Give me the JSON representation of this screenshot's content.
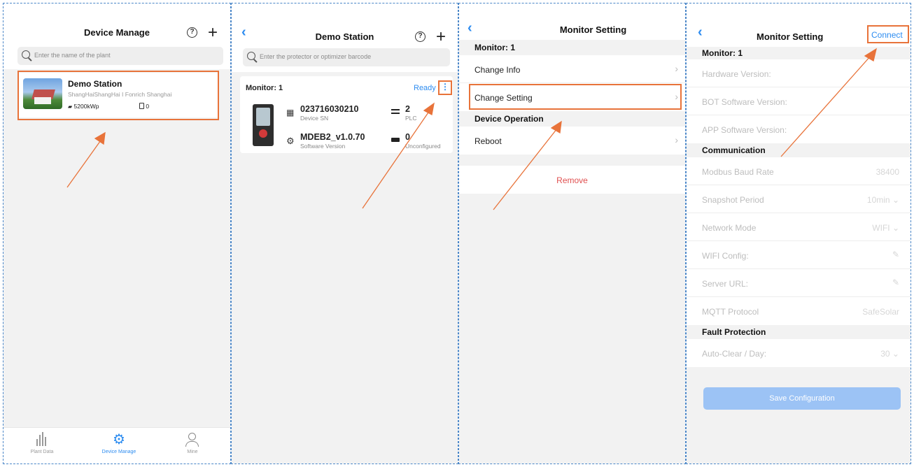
{
  "colors": {
    "accent": "#2d8cf0",
    "highlight": "#e8733a",
    "danger": "#e05050"
  },
  "panel1": {
    "title": "Device Manage",
    "search_placeholder": "Enter the name of the plant",
    "station": {
      "name": "Demo Station",
      "address": "ShangHaiShangHai I Fonrich Shanghai",
      "capacity": "5200kWp",
      "count": "0"
    },
    "tabbar": [
      {
        "label": "Plant Data",
        "icon": "bar-chart-icon"
      },
      {
        "label": "Device Manage",
        "icon": "gear-icon"
      },
      {
        "label": "Mine",
        "icon": "user-icon"
      }
    ]
  },
  "panel2": {
    "title": "Demo Station",
    "search_placeholder": "Enter the protector or optimizer barcode",
    "monitor_label": "Monitor: 1",
    "status": "Ready",
    "device_sn": "023716030210",
    "device_sn_label": "Device SN",
    "plc_count": "2",
    "plc_label": "PLC",
    "software_version": "MDEB2_v1.0.70",
    "software_version_label": "Software Version",
    "unconfigured_count": "0",
    "unconfigured_label": "Unconfigured"
  },
  "panel3": {
    "title": "Monitor Setting",
    "monitor_label": "Monitor: 1",
    "change_info": "Change Info",
    "change_setting": "Change Setting",
    "device_operation": "Device Operation",
    "reboot": "Reboot",
    "remove": "Remove"
  },
  "panel4": {
    "title": "Monitor Setting",
    "connect": "Connect",
    "monitor_label": "Monitor: 1",
    "hardware_version": "Hardware Version:",
    "bot_software_version": "BOT Software Version:",
    "app_software_version": "APP Software Version:",
    "communication": "Communication",
    "modbus_baud_rate": "Modbus Baud Rate",
    "modbus_baud_rate_value": "38400",
    "snapshot_period": "Snapshot Period",
    "snapshot_period_value": "10min ⌄",
    "network_mode": "Network Mode",
    "network_mode_value": "WIFI ⌄",
    "wifi_config": "WIFI Config:",
    "server_url": "Server URL:",
    "mqtt_protocol": "MQTT Protocol",
    "mqtt_protocol_value": "SafeSolar",
    "fault_protection": "Fault Protection",
    "auto_clear": "Auto-Clear / Day:",
    "auto_clear_value": "30 ⌄",
    "save_configuration": "Save Configuration"
  }
}
